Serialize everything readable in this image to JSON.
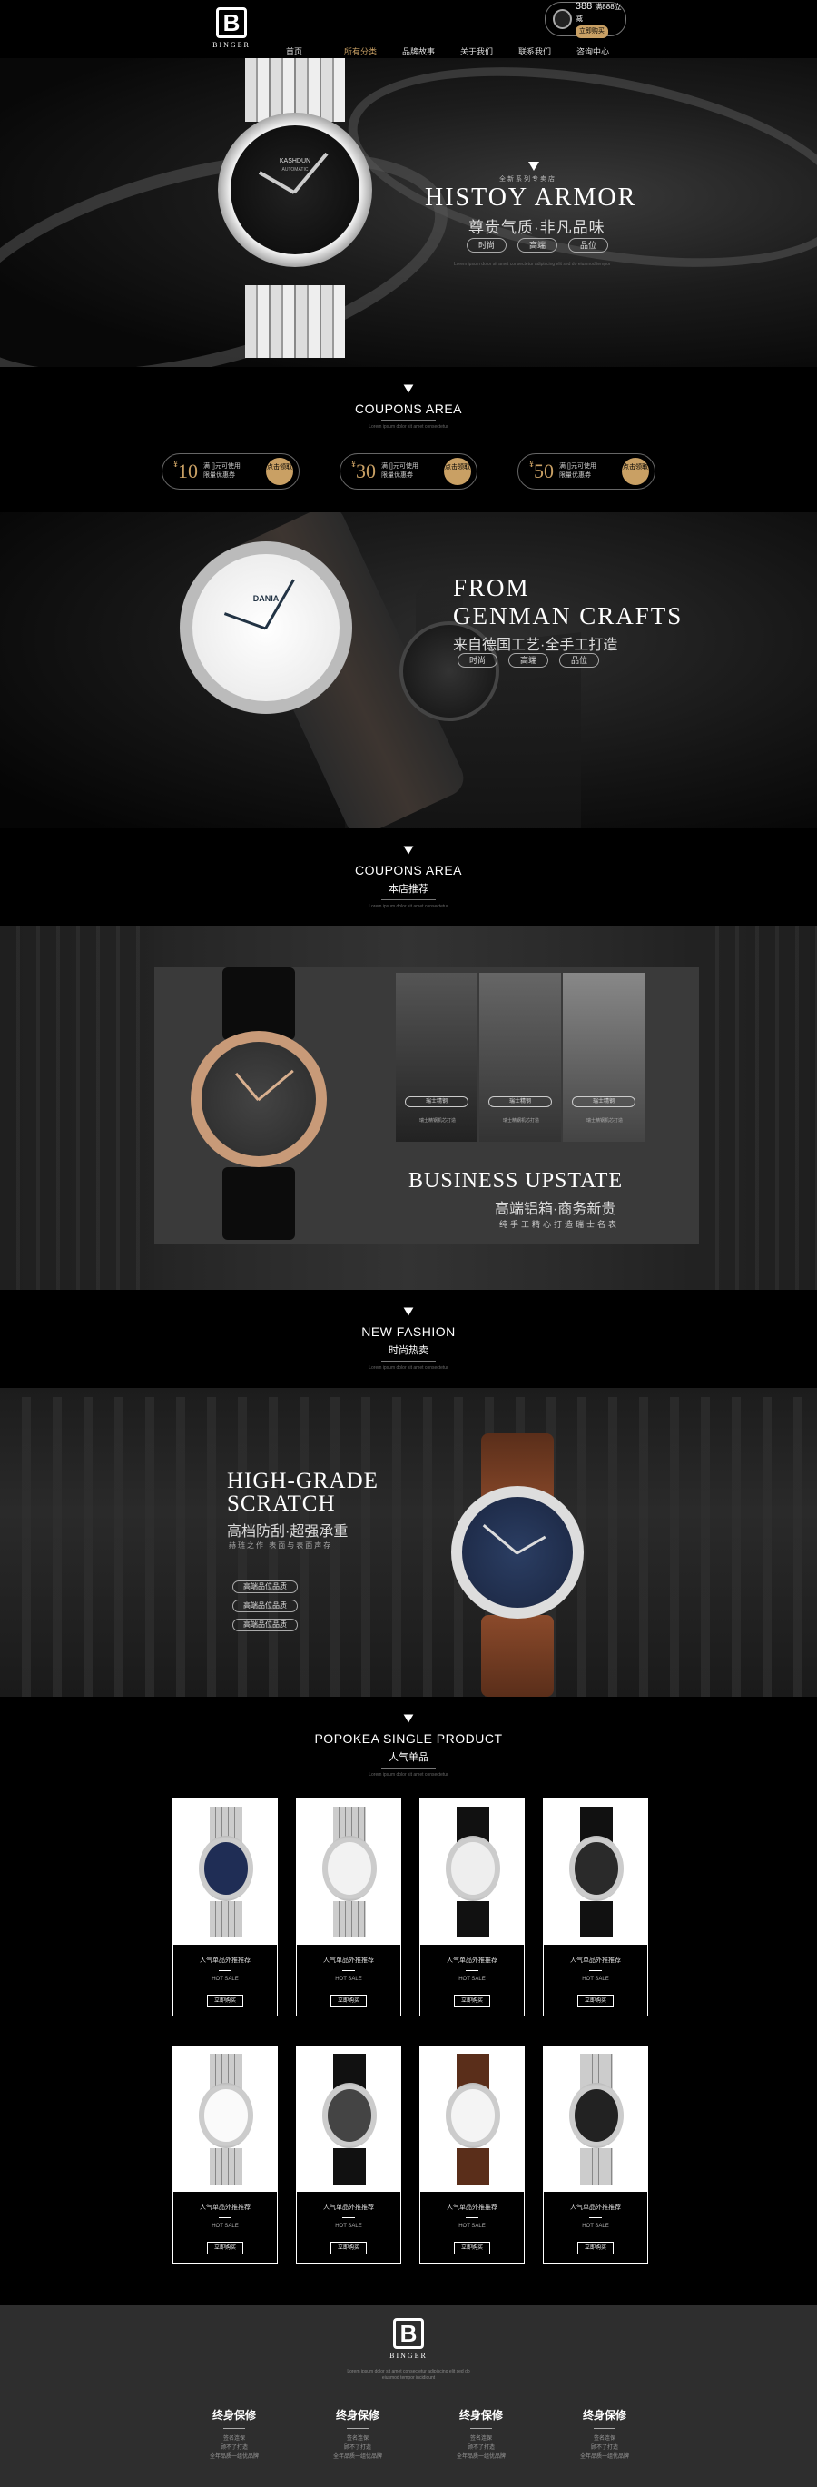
{
  "header": {
    "logo_letter": "B",
    "logo_text": "BINGER",
    "nav": [
      "首页",
      "所有分类",
      "品牌故事",
      "关于我们",
      "联系我们",
      "咨询中心"
    ],
    "nav_active_index": 1,
    "promo": {
      "price": "388",
      "text": "满888立减",
      "button": "立即购买"
    }
  },
  "hero1": {
    "small_text": "全新系列专卖店",
    "title": "HISTOY ARMOR",
    "subtitle": "尊贵气质·非凡品味",
    "pills": [
      "时尚",
      "高端",
      "品位"
    ],
    "watch_brand": "KASHDUN",
    "watch_sub": "AUTOMATIC",
    "fine": "Lorem ipsum dolor sit amet consectetur adipiscing elit sed do eiusmod tempor"
  },
  "coupons": {
    "title": "COUPONS AREA",
    "fine": "Lorem ipsum dolor sit amet consectetur",
    "items": [
      {
        "amount": "10",
        "line1": "满 []元可使用",
        "line2": "限量优惠券",
        "get": "点击领取"
      },
      {
        "amount": "30",
        "line1": "满 []元可使用",
        "line2": "限量优惠券",
        "get": "点击领取"
      },
      {
        "amount": "50",
        "line1": "满 []元可使用",
        "line2": "限量优惠券",
        "get": "点击领取"
      }
    ]
  },
  "hero2": {
    "title_line1": "FROM",
    "title_line2": "GENMAN CRAFTS",
    "subtitle": "来自德国工艺·全手工打造",
    "pills": [
      "时尚",
      "高端",
      "品位"
    ],
    "watch_brand": "DANIA"
  },
  "sec3": {
    "title": "COUPONS AREA",
    "subtitle": "本店推荐",
    "fine": "Lorem ipsum dolor sit amet consectetur"
  },
  "business": {
    "title": "BUSINESS UPSTATE",
    "subtitle": "高端铝箱·商务新贵",
    "small": "纯手工精心打造瑞士名表",
    "photo_labels": [
      "瑞士精钢",
      "瑞士精钢",
      "瑞士精钢"
    ],
    "photo_captions": [
      "瑞士精钢机芯打造",
      "瑞士精钢机芯打造",
      "瑞士精钢机芯打造"
    ]
  },
  "sec4": {
    "title": "NEW FASHION",
    "subtitle": "时尚热卖",
    "fine": "Lorem ipsum dolor sit amet consectetur"
  },
  "highgrade": {
    "title_line1": "HIGH-GRADE",
    "title_line2": "SCRATCH",
    "subtitle": "高档防刮·超强承重",
    "small": "赫琏之作 表面与表面声存",
    "buttons": [
      "高端品位品质",
      "高端品位品质",
      "高端品位品质"
    ]
  },
  "products": {
    "title": "POPOKEA SINGLE PRODUCT",
    "subtitle": "人气单品",
    "fine": "Lorem ipsum dolor sit amet consectetur",
    "items": [
      {
        "name": "人气单品外推推荐",
        "hot": "HOT SALE",
        "button": "立即购买"
      },
      {
        "name": "人气单品外推推荐",
        "hot": "HOT SALE",
        "button": "立即购买"
      },
      {
        "name": "人气单品外推推荐",
        "hot": "HOT SALE",
        "button": "立即购买"
      },
      {
        "name": "人气单品外推推荐",
        "hot": "HOT SALE",
        "button": "立即购买"
      },
      {
        "name": "人气单品外推推荐",
        "hot": "HOT SALE",
        "button": "立即购买"
      },
      {
        "name": "人气单品外推推荐",
        "hot": "HOT SALE",
        "button": "立即购买"
      },
      {
        "name": "人气单品外推推荐",
        "hot": "HOT SALE",
        "button": "立即购买"
      },
      {
        "name": "人气单品外推推荐",
        "hot": "HOT SALE",
        "button": "立即购买"
      }
    ]
  },
  "footer": {
    "logo_letter": "B",
    "logo_text": "BINGER",
    "fine": "Lorem ipsum dolor sit amet consectetur adipiscing elit sed do eiusmod tempor incididunt",
    "guarantees": [
      {
        "title": "终身保修",
        "l1": "签名连保",
        "l2": "顾不了打造",
        "l3": "全年品质一组优品牌"
      },
      {
        "title": "终身保修",
        "l1": "签名连保",
        "l2": "顾不了打造",
        "l3": "全年品质一组优品牌"
      },
      {
        "title": "终身保修",
        "l1": "签名连保",
        "l2": "顾不了打造",
        "l3": "全年品质一组优品牌"
      },
      {
        "title": "终身保修",
        "l1": "签名连保",
        "l2": "顾不了打造",
        "l3": "全年品质一组优品牌"
      }
    ]
  },
  "colors": {
    "gold": "#c9a064",
    "bg": "#000000",
    "footer_bg": "#2e2e2e"
  }
}
